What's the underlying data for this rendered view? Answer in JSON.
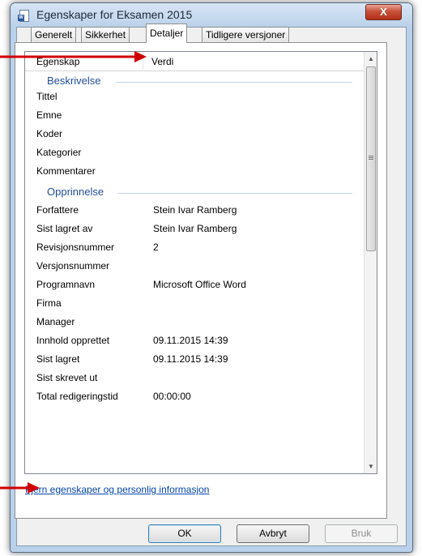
{
  "window": {
    "title": "Egenskaper for Eksamen 2015",
    "close_label": "X"
  },
  "tabs": [
    "Generelt",
    "Sikkerhet",
    "Detaljer",
    "Tidligere versjoner"
  ],
  "active_tab": "Detaljer",
  "columns": {
    "property": "Egenskap",
    "value": "Verdi"
  },
  "groups": [
    {
      "name": "Beskrivelse",
      "rows": [
        {
          "k": "Tittel",
          "v": ""
        },
        {
          "k": "Emne",
          "v": ""
        },
        {
          "k": "Koder",
          "v": ""
        },
        {
          "k": "Kategorier",
          "v": ""
        },
        {
          "k": "Kommentarer",
          "v": ""
        }
      ]
    },
    {
      "name": "Opprinnelse",
      "rows": [
        {
          "k": "Forfattere",
          "v": "Stein Ivar Ramberg"
        },
        {
          "k": "Sist lagret av",
          "v": "Stein Ivar Ramberg"
        },
        {
          "k": "Revisjonsnummer",
          "v": "2"
        },
        {
          "k": "Versjonsnummer",
          "v": ""
        },
        {
          "k": "Programnavn",
          "v": "Microsoft Office Word"
        },
        {
          "k": "Firma",
          "v": ""
        },
        {
          "k": "Manager",
          "v": ""
        },
        {
          "k": "Innhold opprettet",
          "v": "09.11.2015 14:39"
        },
        {
          "k": "Sist lagret",
          "v": "09.11.2015 14:39"
        },
        {
          "k": "Sist skrevet ut",
          "v": ""
        },
        {
          "k": "Total redigeringstid",
          "v": "00:00:00"
        }
      ]
    }
  ],
  "remove_link": "Fjern egenskaper og personlig informasjon",
  "buttons": {
    "ok": "OK",
    "cancel": "Avbryt",
    "apply": "Bruk"
  },
  "annotation_color": "#d10000"
}
